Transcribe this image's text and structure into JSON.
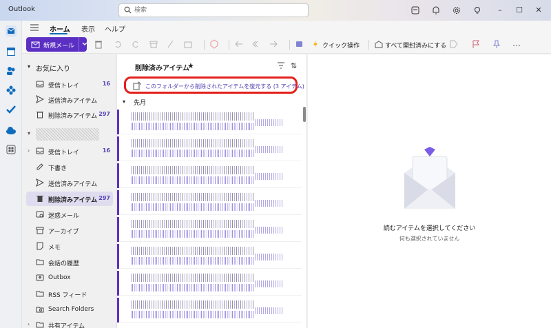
{
  "app": {
    "title": "Outlook"
  },
  "search": {
    "placeholder": "検索"
  },
  "ribbon": {
    "tabs": [
      {
        "label": "ホーム",
        "active": true
      },
      {
        "label": "表示",
        "active": false
      },
      {
        "label": "ヘルプ",
        "active": false
      }
    ],
    "new_mail_label": "新規メール",
    "quick_steps_label": "クイック操作",
    "mark_all_read_label": "すべて開封済みにする"
  },
  "favorites": {
    "header": "お気に入り",
    "items": [
      {
        "label": "受信トレイ",
        "count": "16",
        "icon": "inbox-icon"
      },
      {
        "label": "送信済みアイテム",
        "count": "",
        "icon": "send-icon"
      },
      {
        "label": "削除済みアイテム",
        "count": "297",
        "icon": "trash-icon"
      }
    ]
  },
  "account": {
    "items": [
      {
        "label": "受信トレイ",
        "count": "16",
        "icon": "inbox-icon",
        "expandable": true
      },
      {
        "label": "下書き",
        "count": "",
        "icon": "pencil-icon"
      },
      {
        "label": "送信済みアイテム",
        "count": "",
        "icon": "send-icon"
      },
      {
        "label": "削除済みアイテム",
        "count": "297",
        "icon": "trash-icon",
        "selected": true
      },
      {
        "label": "迷惑メール",
        "count": "",
        "icon": "junk-icon"
      },
      {
        "label": "アーカイブ",
        "count": "",
        "icon": "archive-icon"
      },
      {
        "label": "メモ",
        "count": "",
        "icon": "note-icon"
      },
      {
        "label": "会話の履歴",
        "count": "",
        "icon": "folder-icon"
      },
      {
        "label": "Outbox",
        "count": "",
        "icon": "outbox-icon"
      },
      {
        "label": "RSS フィード",
        "count": "",
        "icon": "folder-icon"
      },
      {
        "label": "Search Folders",
        "count": "",
        "icon": "search-folder-icon"
      },
      {
        "label": "共有アイテム",
        "count": "",
        "icon": "folder-icon",
        "expandable": true
      }
    ]
  },
  "message_list": {
    "title": "削除済みアイテム",
    "restore_banner": "このフォルダーから削除されたアイテムを復元する (3 アイテム)",
    "group_header": "先月",
    "row_count": 8
  },
  "reading_pane": {
    "empty_title": "読むアイテムを選択してください",
    "empty_subtitle": "何も選択されていません"
  },
  "colors": {
    "accent": "#5b2fc4",
    "highlight": "#e3201b",
    "link": "#4f3fb3"
  }
}
